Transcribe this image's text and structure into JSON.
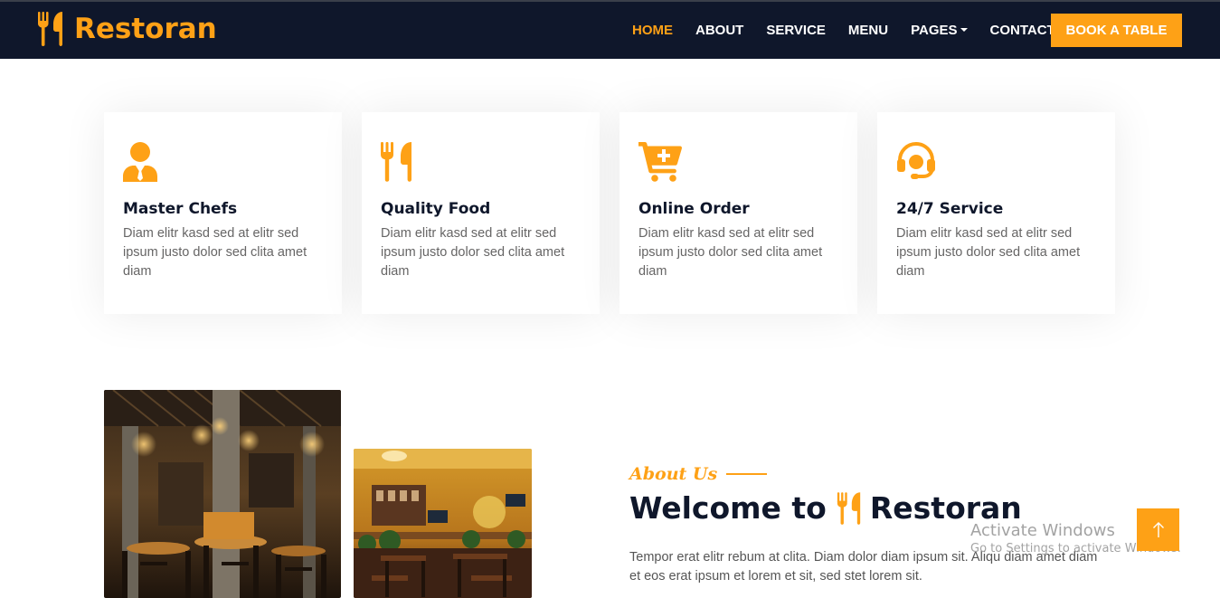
{
  "navbar": {
    "brand": "Restoran",
    "links": [
      {
        "label": "Home",
        "active": true
      },
      {
        "label": "About"
      },
      {
        "label": "Service"
      },
      {
        "label": "Menu"
      },
      {
        "label": "Pages"
      },
      {
        "label": "Contact"
      }
    ],
    "cta": "Book A Table"
  },
  "services": [
    {
      "icon": "user-tie-icon",
      "title": "Master Chefs",
      "text": "Diam elitr kasd sed at elitr sed ipsum justo dolor sed clita amet diam"
    },
    {
      "icon": "utensils-icon",
      "title": "Quality Food",
      "text": "Diam elitr kasd sed at elitr sed ipsum justo dolor sed clita amet diam"
    },
    {
      "icon": "cart-plus-icon",
      "title": "Online Order",
      "text": "Diam elitr kasd sed at elitr sed ipsum justo dolor sed clita amet diam"
    },
    {
      "icon": "headset-icon",
      "title": "24/7 Service",
      "text": "Diam elitr kasd sed at elitr sed ipsum justo dolor sed clita amet diam"
    }
  ],
  "about": {
    "subtitle": "About Us",
    "title_prefix": "Welcome to",
    "title_brand": "Restoran",
    "paragraph": "Tempor erat elitr rebum at clita. Diam dolor diam ipsum sit. Aliqu diam amet diam et eos erat ipsum et lorem et sit, sed stet lorem sit."
  },
  "watermark": {
    "title": "Activate Windows",
    "subtitle": "Go to Settings to activate Windows."
  },
  "colors": {
    "primary": "#fea116",
    "dark": "#0f172b"
  }
}
